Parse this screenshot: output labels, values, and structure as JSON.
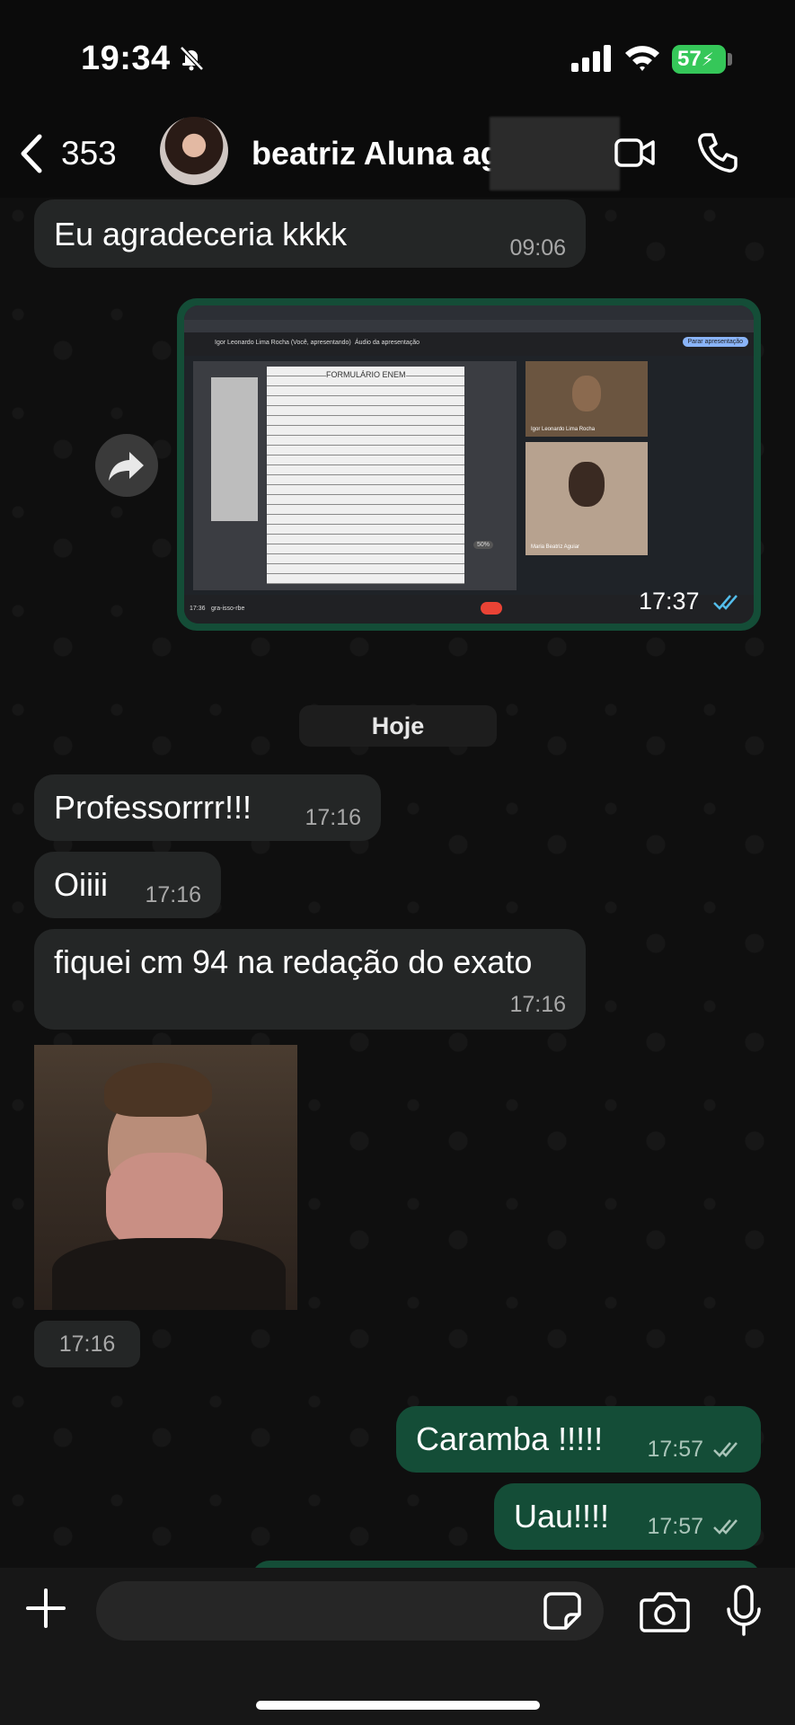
{
  "status_bar": {
    "time": "19:34",
    "battery": "57"
  },
  "header": {
    "back_count": "353",
    "contact_name": "beatriz Aluna ag"
  },
  "messages": [
    {
      "text": "Eu agradeceria kkkk",
      "time": "09:06"
    },
    {
      "image_time": "17:37"
    },
    {
      "date_separator": "Hoje"
    },
    {
      "text": "Professorrrr!!!",
      "time": "17:16"
    },
    {
      "text": "Oiiii",
      "time": "17:16"
    },
    {
      "text": "fiquei cm 94 na redação do exato",
      "time": "17:16"
    },
    {
      "gif_time": "17:16"
    },
    {
      "text": "Caramba !!!!!",
      "time": "17:57"
    },
    {
      "text": "Uau!!!!",
      "time": "17:57"
    }
  ],
  "screenshot": {
    "doc_title": "FORMULÁRIO ENEM",
    "presenter": "Igor Leonardo Lima Rocha (Você, apresentando)",
    "audio_label": "Áudio da apresentação",
    "stop_button": "Parar apresentação",
    "tile1_name": "Igor Leonardo Lima Rocha",
    "tile2_name": "Maria Beatriz Aguiar",
    "meet_time": "17:36",
    "meet_code": "gra-isso-rbe",
    "zoom": "50%"
  },
  "colors": {
    "incoming": "#242626",
    "outgoing": "#144d37",
    "read_tick": "#53bdeb"
  }
}
